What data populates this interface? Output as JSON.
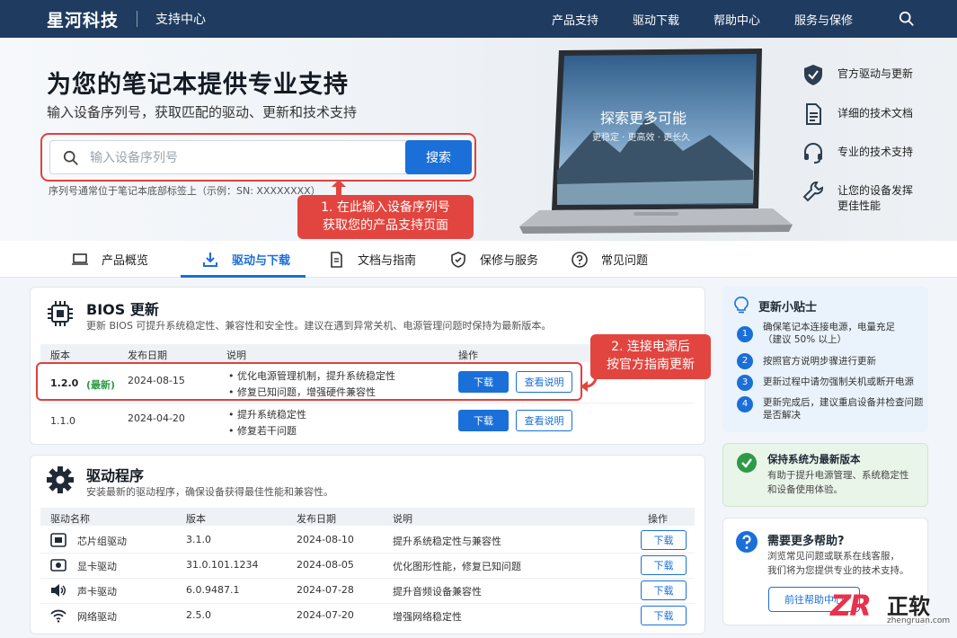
{
  "topbar": {
    "brand": "星河科技",
    "subtitle": "支持中心",
    "nav": [
      "产品支持",
      "驱动下载",
      "帮助中心",
      "服务与保修"
    ]
  },
  "hero": {
    "title": "为您的笔记本提供专业支持",
    "subtitle": "输入设备序列号，获取匹配的驱动、更新和技术支持",
    "search_placeholder": "输入设备序列号",
    "search_button": "搜索",
    "note": "序列号通常位于笔记本底部标签上（示例：SN: XXXXXXXX）",
    "callout_line1": "1. 在此输入设备序列号",
    "callout_line2": "获取您的产品支持页面",
    "laptop_screen_title": "探索更多可能",
    "laptop_screen_sub": "更稳定 · 更高效 · 更长久",
    "features": [
      "官方驱动与更新",
      "详细的技术文档",
      "专业的技术支持",
      "让您的设备发挥",
      "更佳性能"
    ]
  },
  "tabs": [
    "产品概览",
    "驱动与下载",
    "文档与指南",
    "保修与服务",
    "常见问题"
  ],
  "bios": {
    "title": "BIOS 更新",
    "desc": "更新 BIOS 可提升系统稳定性、兼容性和安全性。建议在遇到异常关机、电源管理问题时保持为最新版本。",
    "columns": [
      "版本",
      "发布日期",
      "说明",
      "操作"
    ],
    "rows": [
      {
        "version": "1.2.0",
        "tag": "(最新)",
        "date": "2024-08-15",
        "notes": [
          "• 优化电源管理机制，提升系统稳定性",
          "• 修复已知问题，增强硬件兼容性"
        ],
        "download": "下载",
        "details": "查看说明"
      },
      {
        "version": "1.1.0",
        "tag": "",
        "date": "2024-04-20",
        "notes": [
          "• 提升系统稳定性",
          "• 修复若干问题"
        ],
        "download": "下载",
        "details": "查看说明"
      }
    ],
    "callout_line1": "2. 连接电源后",
    "callout_line2": "按官方指南更新"
  },
  "drivers": {
    "title": "驱动程序",
    "desc": "安装最新的驱动程序，确保设备获得最佳性能和兼容性。",
    "columns": [
      "驱动名称",
      "版本",
      "发布日期",
      "说明",
      "操作"
    ],
    "rows": [
      {
        "name": "芯片组驱动",
        "version": "3.1.0",
        "date": "2024-08-10",
        "desc": "提升系统稳定性与兼容性",
        "action": "下载"
      },
      {
        "name": "显卡驱动",
        "version": "31.0.101.1234",
        "date": "2024-08-05",
        "desc": "优化图形性能，修复已知问题",
        "action": "下载"
      },
      {
        "name": "声卡驱动",
        "version": "6.0.9487.1",
        "date": "2024-07-28",
        "desc": "提升音频设备兼容性",
        "action": "下载"
      },
      {
        "name": "网络驱动",
        "version": "2.5.0",
        "date": "2024-07-20",
        "desc": "增强网络稳定性",
        "action": "下载"
      }
    ]
  },
  "tips": {
    "title": "更新小贴士",
    "items": [
      {
        "num": "1",
        "line1": "确保笔记本连接电源，电量充足",
        "line2": "（建议 50% 以上）"
      },
      {
        "num": "2",
        "line1": "按照官方说明步骤进行更新",
        "line2": ""
      },
      {
        "num": "3",
        "line1": "更新过程中请勿强制关机或断开电源",
        "line2": ""
      },
      {
        "num": "4",
        "line1": "更新完成后，建议重启设备并检查问题",
        "line2": "是否解决"
      }
    ]
  },
  "ok": {
    "title": "保持系统为最新版本",
    "line1": "有助于提升电源管理、系统稳定性",
    "line2": "和设备使用体验。"
  },
  "help": {
    "title": "需要更多帮助?",
    "line1": "浏览常见问题或联系在线客服，",
    "line2": "我们将为您提供专业的技术支持。",
    "button": "前往帮助中心"
  },
  "watermark": {
    "logo": "ZR",
    "name": "正软",
    "url": "zhengruan.com"
  },
  "colors": {
    "nav_bg": "#1f3b5f",
    "accent": "#1a6fd8",
    "callout": "#e2453f",
    "success": "#2e9a47"
  }
}
